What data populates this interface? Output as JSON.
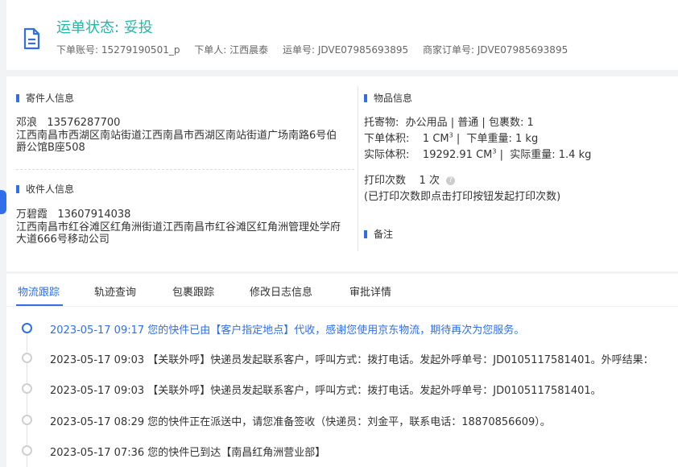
{
  "header": {
    "icon": "document-icon",
    "status_title": "运单状态: 妥投",
    "order_account": "下单账号: 15279190501_p",
    "orderer": "下单人: 江西晨泰",
    "waybill_no": "运单号: JDVE07985693895",
    "merchant_order_no": "商家订单号: JDVE07985693895"
  },
  "sender": {
    "section_title": "寄件人信息",
    "name": "邓浪",
    "phone": "13576287700",
    "address": "江西南昌市西湖区南站街道江西南昌市西湖区南站街道广场南路6号伯爵公馆B座508"
  },
  "receiver": {
    "section_title": "收件人信息",
    "name": "万碧霞",
    "phone": "13607914038",
    "address": "江西南昌市红谷滩区红角洲街道江西南昌市红谷滩区红角洲管理处学府大道666号移动公司"
  },
  "goods": {
    "section_title": "物品信息",
    "consign_label": "托寄物:",
    "consign_value": "办公用品 | 普通 | 包裹数: 1",
    "order_volume_label": "下单体积:",
    "order_volume_value": "1 CM",
    "order_weight": "下单重量: 1 kg",
    "actual_volume_label": "实际体积:",
    "actual_volume_value": "19292.91 CM",
    "actual_weight": "实际重量: 1.4 kg",
    "volume_unit_power": "3",
    "print_label": "打印次数",
    "print_value": "1 次",
    "print_hint": "(已打印次数即点击打印按钮发起打印次数)",
    "help_icon": "question-icon"
  },
  "remark": {
    "section_title": "备注"
  },
  "tabs": [
    {
      "label": "物流跟踪"
    },
    {
      "label": "轨迹查询"
    },
    {
      "label": "包裹跟踪"
    },
    {
      "label": "修改日志信息"
    },
    {
      "label": "审批详情"
    }
  ],
  "timeline": [
    {
      "text": "2023-05-17 09:17  您的快件已由【客户指定地点】代收，感谢您使用京东物流，期待再次为您服务。"
    },
    {
      "text": "2023-05-17 09:03  【关联外呼】快递员发起联系客户，呼叫方式：拨打电话。发起外呼单号：JD0105117581401。外呼结果："
    },
    {
      "text": "2023-05-17 09:03  【关联外呼】快递员发起联系客户，呼叫方式：拨打电话。发起外呼单号：JD0105117581401。"
    },
    {
      "text": "2023-05-17 08:29  您的快件正在派送中，请您准备签收（快递员：刘金平，联系电话：18870856609）。"
    },
    {
      "text": "2023-05-17 07:36  您的快件已到达【南昌红角洲营业部】"
    }
  ],
  "colors": {
    "status": "#21b8a6",
    "accent": "#2f6fe8"
  }
}
